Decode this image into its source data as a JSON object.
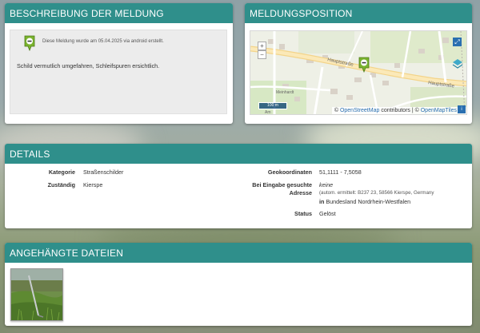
{
  "beschreibung": {
    "title": "BESCHREIBUNG DER MELDUNG",
    "meta": "Diese Meldung wurde am 05.04.2025 via android erstellt.",
    "text": "Schild vermutlich umgefahren, Schleifspuren ersichtlich."
  },
  "position": {
    "title": "MELDUNGSPOSITION",
    "zoom_in": "+",
    "zoom_out": "−",
    "scale_label": "100 m",
    "street_1": "Hauptstraße",
    "street_2": "Hauptstraße",
    "street_3": "Meinhardt",
    "street_4": "Am",
    "attribution_prefix": "©",
    "attribution_osm": "OpenStreetMap",
    "attribution_mid": "contributors | ©",
    "attribution_tiles": "OpenMapTiles",
    "attribution_btn": "i"
  },
  "details": {
    "title": "DETAILS",
    "kategorie_label": "Kategorie",
    "kategorie_value": "Straßenschilder",
    "zustaendig_label": "Zuständig",
    "zustaendig_value": "Kierspe",
    "geo_label": "Geokoordinaten",
    "geo_value": "51,1111 - 7,5058",
    "adresse_label_1": "Bei Eingabe gesuchte",
    "adresse_label_2": "Adresse",
    "adresse_value": "keine",
    "adresse_auto": "(autom. ermittelt: B237 23, 58566 Kierspe, Germany",
    "adresse_in": "in",
    "adresse_bundesland": "Bundesland Nordrhein-Westfalen",
    "status_label": "Status",
    "status_value": "Gelöst"
  },
  "dateien": {
    "title": "ANGEHÄNGTE DATEIEN"
  },
  "colors": {
    "header": "#2f8f8b",
    "marker": "#7ab32e",
    "link": "#2a6fb0"
  }
}
